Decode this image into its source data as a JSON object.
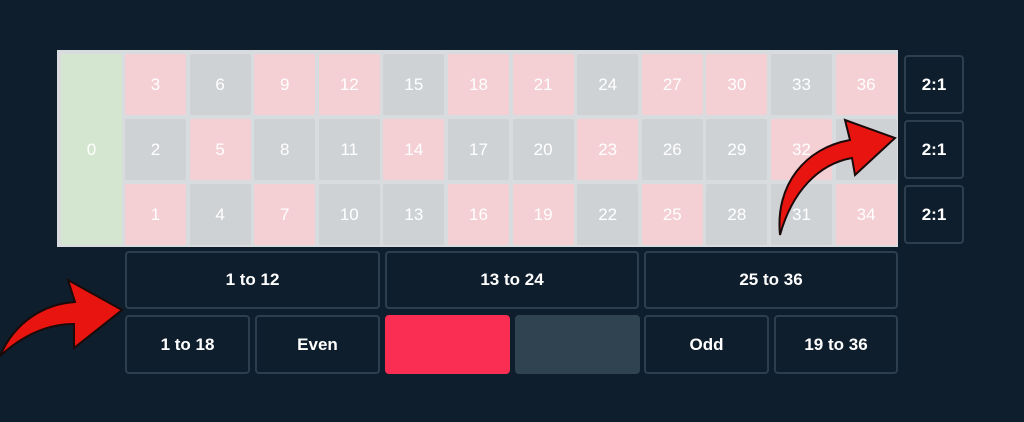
{
  "zero_label": "0",
  "numbers": {
    "row_top": [
      {
        "n": "3",
        "c": "red"
      },
      {
        "n": "6",
        "c": "black"
      },
      {
        "n": "9",
        "c": "red"
      },
      {
        "n": "12",
        "c": "red"
      },
      {
        "n": "15",
        "c": "black"
      },
      {
        "n": "18",
        "c": "red"
      },
      {
        "n": "21",
        "c": "red"
      },
      {
        "n": "24",
        "c": "black"
      },
      {
        "n": "27",
        "c": "red"
      },
      {
        "n": "30",
        "c": "red"
      },
      {
        "n": "33",
        "c": "black"
      },
      {
        "n": "36",
        "c": "red"
      }
    ],
    "row_middle": [
      {
        "n": "2",
        "c": "black"
      },
      {
        "n": "5",
        "c": "red"
      },
      {
        "n": "8",
        "c": "black"
      },
      {
        "n": "11",
        "c": "black"
      },
      {
        "n": "14",
        "c": "red"
      },
      {
        "n": "17",
        "c": "black"
      },
      {
        "n": "20",
        "c": "black"
      },
      {
        "n": "23",
        "c": "red"
      },
      {
        "n": "26",
        "c": "black"
      },
      {
        "n": "29",
        "c": "black"
      },
      {
        "n": "32",
        "c": "red"
      },
      {
        "n": "35",
        "c": "black"
      }
    ],
    "row_bottom": [
      {
        "n": "1",
        "c": "red"
      },
      {
        "n": "4",
        "c": "black"
      },
      {
        "n": "7",
        "c": "red"
      },
      {
        "n": "10",
        "c": "black"
      },
      {
        "n": "13",
        "c": "black"
      },
      {
        "n": "16",
        "c": "red"
      },
      {
        "n": "19",
        "c": "red"
      },
      {
        "n": "22",
        "c": "black"
      },
      {
        "n": "25",
        "c": "red"
      },
      {
        "n": "28",
        "c": "black"
      },
      {
        "n": "31",
        "c": "black"
      },
      {
        "n": "34",
        "c": "red"
      }
    ]
  },
  "column_bets": [
    "2:1",
    "2:1",
    "2:1"
  ],
  "dozens": [
    "1 to 12",
    "13 to 24",
    "25 to 36"
  ],
  "outside_bets": {
    "low": "1 to 18",
    "even": "Even",
    "odd": "Odd",
    "high": "19 to 36"
  },
  "colors": {
    "red_bet": "#fa2d52",
    "black_bet": "#2f4350",
    "background": "#0f1e2c",
    "arrow": "#e8140f"
  },
  "annotations": [
    "red-arrow-icon",
    "red-arrow-icon"
  ]
}
